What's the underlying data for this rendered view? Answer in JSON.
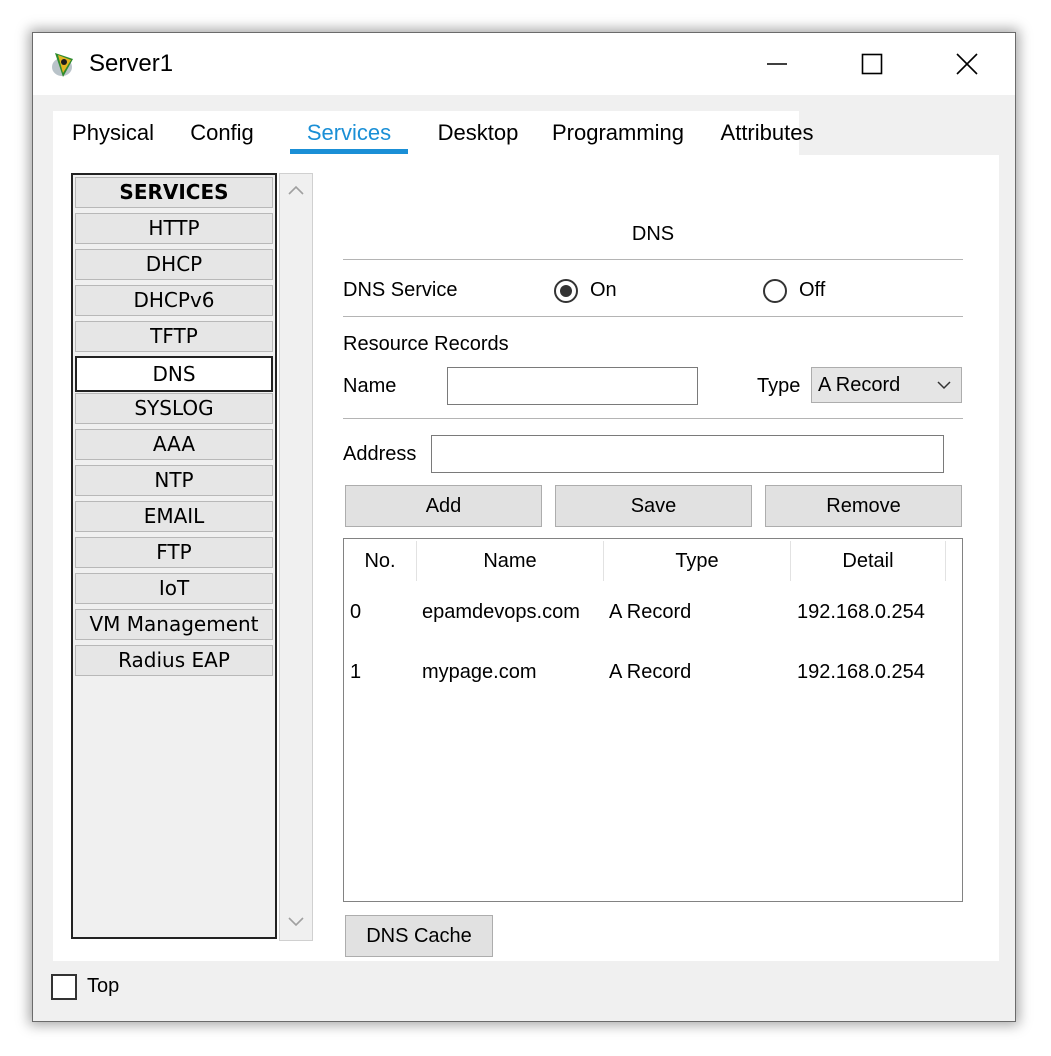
{
  "window": {
    "title": "Server1",
    "app_icon": "packet-tracer-server-icon"
  },
  "title_buttons": [
    "minimize-icon",
    "maximize-icon",
    "close-icon"
  ],
  "tabs": [
    {
      "label": "Physical",
      "active": false
    },
    {
      "label": "Config",
      "active": false
    },
    {
      "label": "Services",
      "active": true
    },
    {
      "label": "Desktop",
      "active": false
    },
    {
      "label": "Programming",
      "active": false
    },
    {
      "label": "Attributes",
      "active": false
    }
  ],
  "accent_color": "#1a8fd6",
  "services": {
    "header": "SERVICES",
    "items": [
      "HTTP",
      "DHCP",
      "DHCPv6",
      "TFTP",
      "DNS",
      "SYSLOG",
      "AAA",
      "NTP",
      "EMAIL",
      "FTP",
      "IoT",
      "VM Management",
      "Radius EAP"
    ],
    "selected": "DNS"
  },
  "dns": {
    "title": "DNS",
    "service_label": "DNS Service",
    "on_label": "On",
    "off_label": "Off",
    "service_state": "On",
    "resource_records_label": "Resource Records",
    "name_label": "Name",
    "name_value": "",
    "type_label": "Type",
    "type_value": "A Record",
    "address_label": "Address",
    "address_value": "",
    "add_label": "Add",
    "save_label": "Save",
    "remove_label": "Remove",
    "cache_label": "DNS Cache"
  },
  "records": {
    "columns": [
      "No.",
      "Name",
      "Type",
      "Detail"
    ],
    "rows": [
      {
        "no": "0",
        "name": "epamdevops.com",
        "type": "A Record",
        "detail": "192.168.0.254"
      },
      {
        "no": "1",
        "name": "mypage.com",
        "type": "A Record",
        "detail": "192.168.0.254"
      }
    ]
  },
  "bottom": {
    "top_label": "Top",
    "top_checked": false
  }
}
